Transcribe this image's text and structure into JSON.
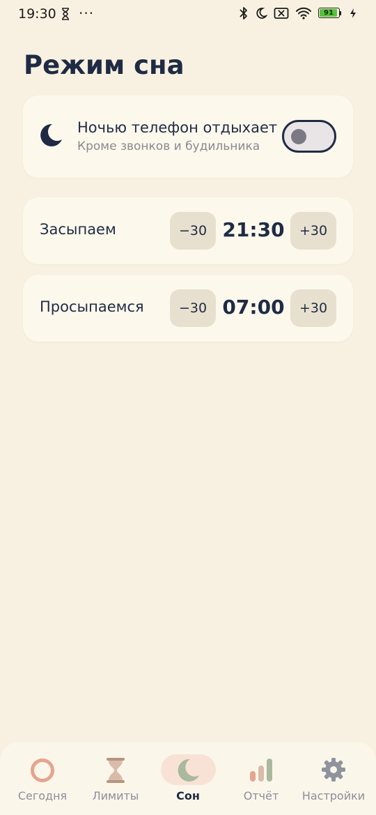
{
  "status_bar": {
    "time": "19:30",
    "dots": "···",
    "battery_level": "91",
    "icons": [
      "hourglass-icon",
      "bluetooth-icon",
      "moon-icon",
      "sim-off-icon",
      "wifi-icon",
      "battery-icon",
      "charging-icon"
    ],
    "battery_color": "#58c23a"
  },
  "page": {
    "title": "Режим сна"
  },
  "night_mode": {
    "icon": "moon-icon",
    "title": "Ночью телефон отдыхает",
    "subtitle": "Кроме звонков и будильника",
    "enabled": false
  },
  "schedule": [
    {
      "label": "Засыпаем",
      "minus_label": "−30",
      "time": "21:30",
      "plus_label": "+30"
    },
    {
      "label": "Просыпаемся",
      "minus_label": "−30",
      "time": "07:00",
      "plus_label": "+30"
    }
  ],
  "bottom_nav": {
    "items": [
      {
        "label": "Сегодня",
        "icon": "ring-icon",
        "active": false
      },
      {
        "label": "Лимиты",
        "icon": "hourglass-icon",
        "active": false
      },
      {
        "label": "Сон",
        "icon": "moon-icon",
        "active": true
      },
      {
        "label": "Отчёт",
        "icon": "bar-chart-icon",
        "active": false
      },
      {
        "label": "Настройки",
        "icon": "gear-icon",
        "active": false
      }
    ]
  },
  "colors": {
    "background": "#f8f1e1",
    "card": "#fcf8ec",
    "text_primary": "#1f2b45",
    "text_secondary": "#8a8a8f",
    "button": "#e8e0cf",
    "active_tab_pill": "#f8e2d6"
  }
}
